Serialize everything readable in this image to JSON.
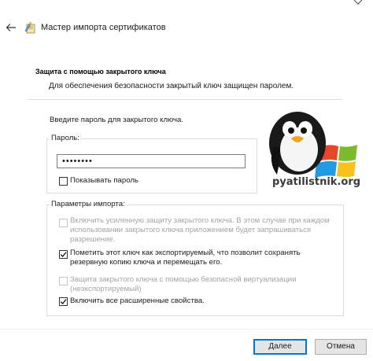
{
  "window": {
    "title": "Мастер импорта сертификатов",
    "back_icon": "back-arrow-icon",
    "wizard_icon": "certificate-wizard-icon",
    "close_icon": "close-icon"
  },
  "header": {
    "title": "Защита с помощью закрытого ключа",
    "subtitle": "Для обеспечения безопасности закрытый ключ защищен паролем."
  },
  "prompt": "Введите пароль для закрытого ключа.",
  "password_group": {
    "label": "Пароль:",
    "value": "••••••••",
    "show_password": {
      "label": "Показывать пароль",
      "checked": false
    }
  },
  "import_params": {
    "label": "Параметры импорта:",
    "options": [
      {
        "line1": "Включить усиленную защиту закрытого ключа. В этом случае при каждом",
        "line2": "использовании закрытого ключа приложением будет запрашиваться",
        "line3": "разрешение.",
        "checked": false,
        "enabled": false
      },
      {
        "line1": "Пометить этот ключ как экспортируемый, что позволит сохранять",
        "line2": "резервную копию ключа и перемещать его.",
        "checked": true,
        "enabled": true
      },
      {
        "line1": "Защита закрытого ключа с помощью безопасной виртуализации",
        "line2": "(неэкспортируемый)",
        "checked": false,
        "enabled": false
      },
      {
        "line1": "Включить все расширенные свойства.",
        "checked": true,
        "enabled": true
      }
    ]
  },
  "watermark": {
    "text": "pyatilistnik.org",
    "icon": "penguin-windows-logo"
  },
  "buttons": {
    "next": "Далее",
    "cancel": "Отмена"
  },
  "colors": {
    "accent": "#0078d7",
    "disabled_text": "#a4a4a4"
  }
}
